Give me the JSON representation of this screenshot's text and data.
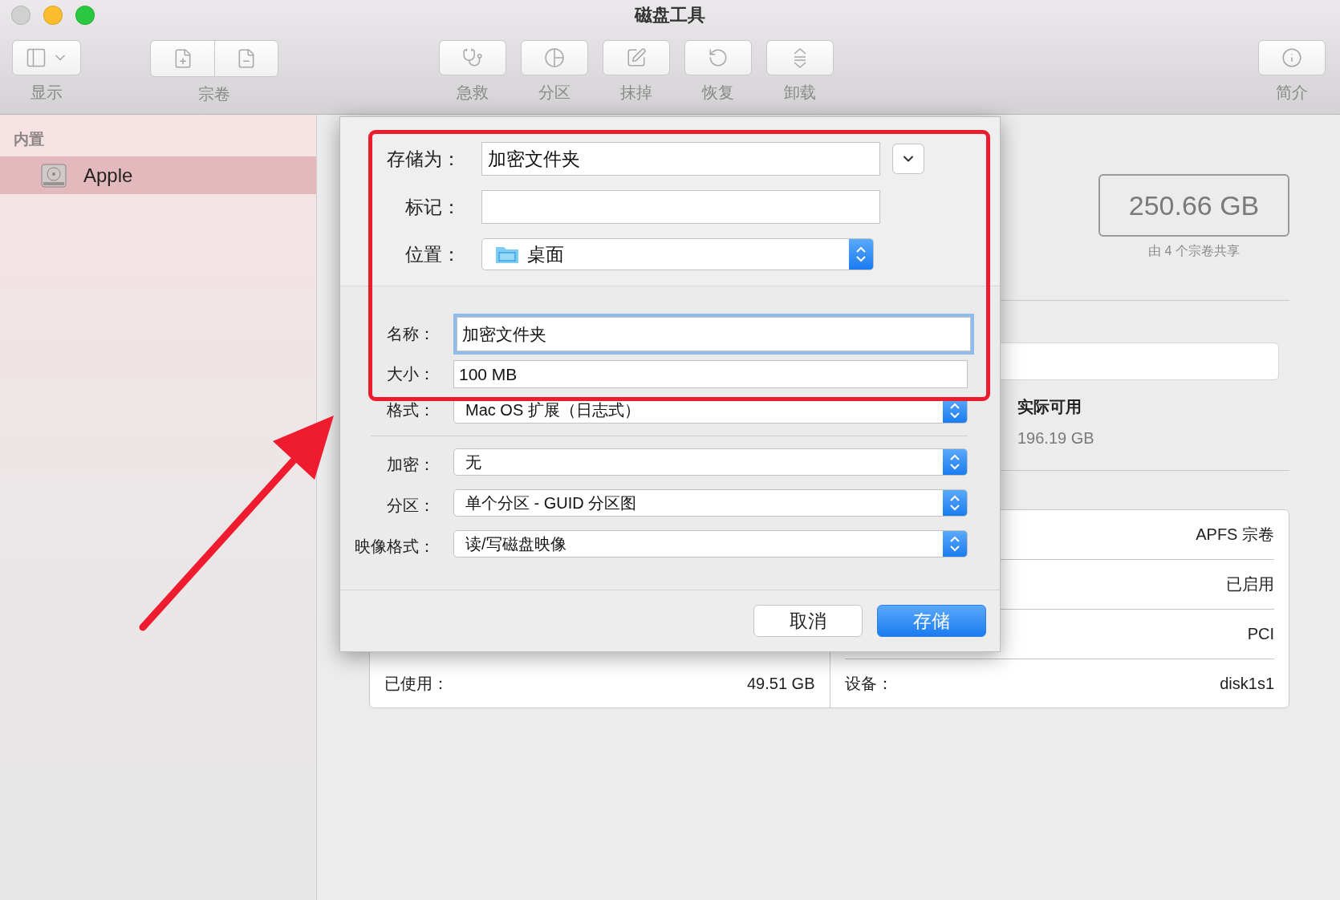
{
  "window": {
    "title": "磁盘工具"
  },
  "toolbar": {
    "items": [
      {
        "kind": "view",
        "label": "显示"
      },
      {
        "kind": "volume",
        "label": "宗卷"
      },
      {
        "kind": "firstaid",
        "label": "急救"
      },
      {
        "kind": "partition",
        "label": "分区"
      },
      {
        "kind": "erase",
        "label": "抹掉"
      },
      {
        "kind": "restore",
        "label": "恢复"
      },
      {
        "kind": "unmount",
        "label": "卸载"
      },
      {
        "kind": "info",
        "label": "简介"
      }
    ]
  },
  "sidebar": {
    "section": "内置",
    "items": [
      {
        "label": "Apple",
        "selected": true
      }
    ]
  },
  "main": {
    "capacity": "250.66 GB",
    "capacity_note": "由 4 个宗卷共享",
    "legend": {
      "label": "实际可用",
      "value": "196.19 GB"
    },
    "info_left": [
      {
        "label": "已使用：",
        "value": "49.51 GB"
      }
    ],
    "info_right": [
      {
        "value": "APFS 宗卷"
      },
      {
        "value": "已启用"
      },
      {
        "value": "PCI"
      },
      {
        "label": "设备：",
        "value": "disk1s1"
      }
    ]
  },
  "dialog": {
    "save_as": {
      "label": "存储为：",
      "value": "加密文件夹"
    },
    "tags": {
      "label": "标记："
    },
    "where": {
      "label": "位置：",
      "value": "桌面"
    },
    "fields": [
      {
        "kind": "text",
        "label": "名称：",
        "value": "加密文件夹",
        "focused": true
      },
      {
        "kind": "text",
        "label": "大小：",
        "value": "100 MB",
        "focused": false
      },
      {
        "kind": "popup",
        "label": "格式：",
        "value": "Mac OS 扩展（日志式）"
      }
    ],
    "options": [
      {
        "label": "加密：",
        "value": "无"
      },
      {
        "label": "分区：",
        "value": "单个分区 - GUID 分区图"
      },
      {
        "label": "映像格式：",
        "value": "读/写磁盘映像"
      }
    ],
    "buttons": [
      {
        "kind": "cancel",
        "label": "取消"
      },
      {
        "kind": "default",
        "label": "存储"
      }
    ]
  }
}
